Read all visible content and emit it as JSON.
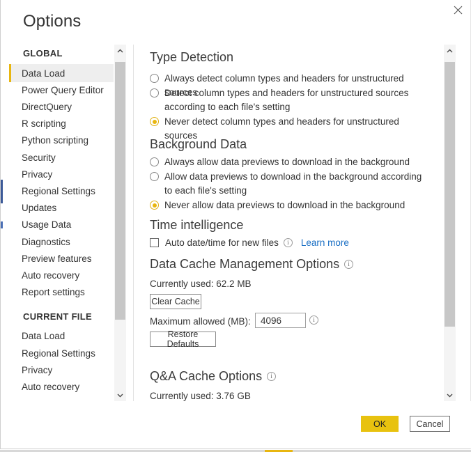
{
  "window": {
    "title": "Options",
    "close_icon": "close-icon"
  },
  "sidebar": {
    "groups": [
      {
        "title": "GLOBAL",
        "items": [
          {
            "label": "Data Load",
            "selected": true
          },
          {
            "label": "Power Query Editor",
            "selected": false
          },
          {
            "label": "DirectQuery",
            "selected": false
          },
          {
            "label": "R scripting",
            "selected": false
          },
          {
            "label": "Python scripting",
            "selected": false
          },
          {
            "label": "Security",
            "selected": false
          },
          {
            "label": "Privacy",
            "selected": false
          },
          {
            "label": "Regional Settings",
            "selected": false
          },
          {
            "label": "Updates",
            "selected": false
          },
          {
            "label": "Usage Data",
            "selected": false
          },
          {
            "label": "Diagnostics",
            "selected": false
          },
          {
            "label": "Preview features",
            "selected": false
          },
          {
            "label": "Auto recovery",
            "selected": false
          },
          {
            "label": "Report settings",
            "selected": false
          }
        ]
      },
      {
        "title": "CURRENT FILE",
        "items": [
          {
            "label": "Data Load",
            "selected": false
          },
          {
            "label": "Regional Settings",
            "selected": false
          },
          {
            "label": "Privacy",
            "selected": false
          },
          {
            "label": "Auto recovery",
            "selected": false
          }
        ]
      }
    ],
    "scrollbar": {
      "up_icon": "chevron-up-icon",
      "down_icon": "chevron-down-icon"
    }
  },
  "content": {
    "type_detection": {
      "heading": "Type Detection",
      "options": [
        {
          "label": "Always detect column types and headers for unstructured sources",
          "selected": false
        },
        {
          "label": "Detect column types and headers for unstructured sources according to each file's setting",
          "selected": false
        },
        {
          "label": "Never detect column types and headers for unstructured sources",
          "selected": true
        }
      ]
    },
    "background_data": {
      "heading": "Background Data",
      "options": [
        {
          "label": "Always allow data previews to download in the background",
          "selected": false
        },
        {
          "label": "Allow data previews to download in the background according to each file's setting",
          "selected": false
        },
        {
          "label": "Never allow data previews to download in the background",
          "selected": true
        }
      ]
    },
    "time_intelligence": {
      "heading": "Time intelligence",
      "checkbox_label": "Auto date/time for new files",
      "checkbox_checked": false,
      "info_icon": "info-icon",
      "link_label": "Learn more"
    },
    "data_cache": {
      "heading": "Data Cache Management Options",
      "heading_info_icon": "info-icon",
      "currently_used": "Currently used: 62.2 MB",
      "clear_cache_label": "Clear Cache",
      "max_allowed_label": "Maximum allowed (MB):",
      "max_allowed_value": "4096",
      "max_allowed_info_icon": "info-icon",
      "restore_defaults_label": "Restore Defaults"
    },
    "qa_cache": {
      "heading": "Q&A Cache Options",
      "heading_info_icon": "info-icon",
      "currently_used": "Currently used: 3.76 GB"
    },
    "scrollbar": {
      "up_icon": "chevron-up-icon",
      "down_icon": "chevron-down-icon"
    }
  },
  "footer": {
    "ok_label": "OK",
    "cancel_label": "Cancel"
  },
  "colors": {
    "accent": "#e8b610",
    "ok_button": "#e8c20f",
    "link": "#1a6fc4",
    "selected_nav_bg": "#eeeeee"
  }
}
